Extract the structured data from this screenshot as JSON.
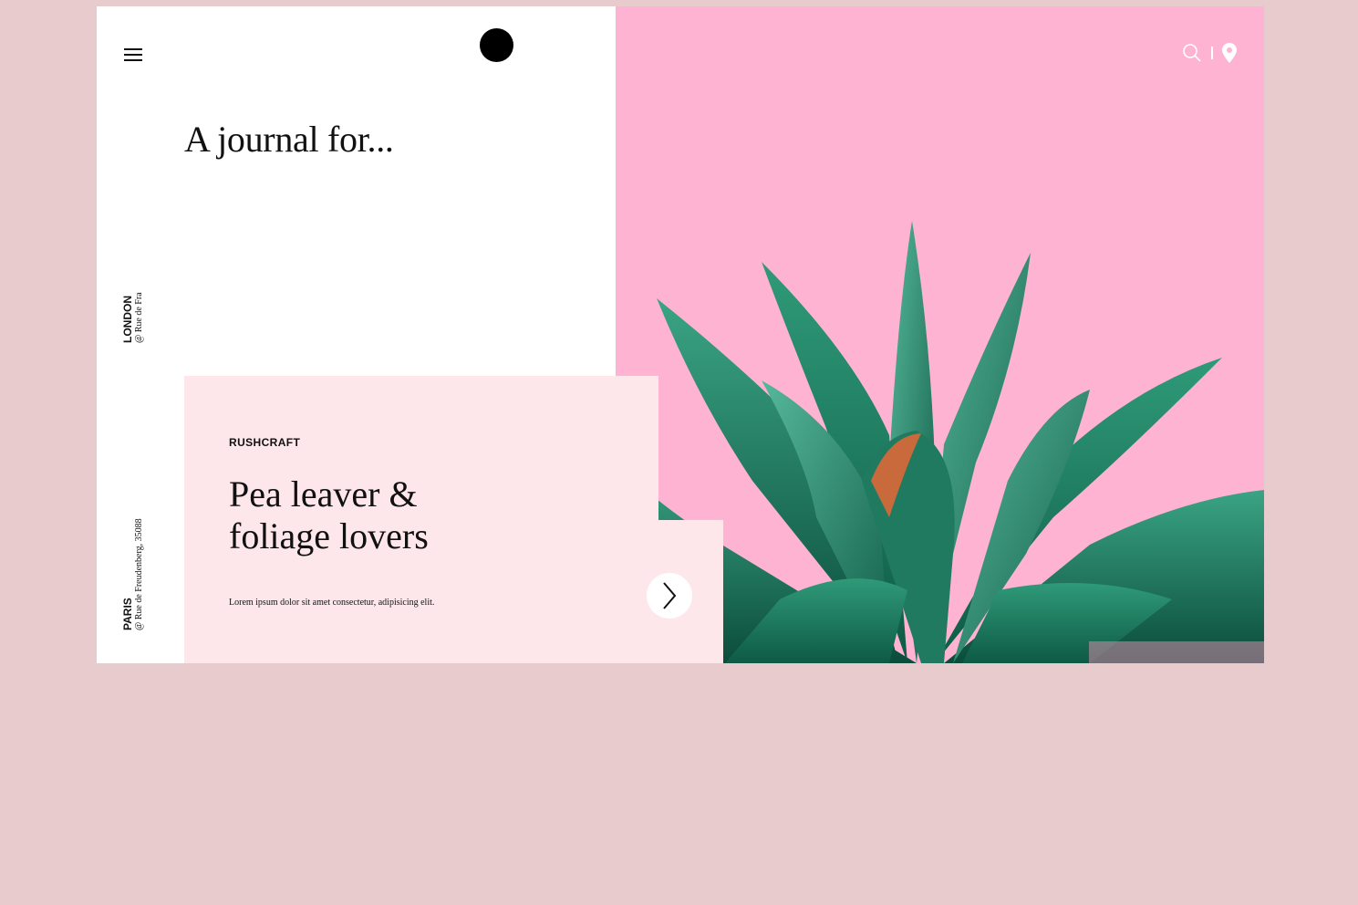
{
  "header": {
    "menu_icon": "hamburger-icon",
    "logo_icon": "black-circle-logo",
    "search_icon": "search-icon",
    "location_icon": "map-pin-icon"
  },
  "hero": {
    "headline": "A journal for..."
  },
  "side_locations": [
    {
      "city": "LONDON",
      "address": "@ Rue de Fra"
    },
    {
      "city": "PARIS",
      "address": "@ Rue de Freudenberg, 35088"
    }
  ],
  "card": {
    "kicker": "RUSHCRAFT",
    "title_line1": "Pea leaver &",
    "title_line2": "foliage lovers",
    "description": "Lorem ipsum dolor sit amet consectetur, adipisicing elit.",
    "next_icon": "chevron-right-icon"
  },
  "colors": {
    "background": "#e8cbcc",
    "hero_pink": "#ffb3d3",
    "card_pink": "#fde7ea",
    "text": "#111111"
  }
}
